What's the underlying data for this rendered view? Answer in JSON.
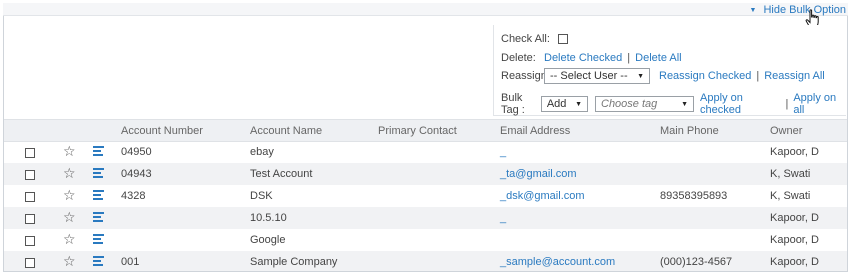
{
  "header": {
    "hide_bulk_label": "Hide Bulk Option"
  },
  "bulk": {
    "check_all_label": "Check All:",
    "delete_label": "Delete:",
    "delete_checked": "Delete Checked",
    "delete_all": "Delete All",
    "reassign_label": "Reassign:",
    "select_user_value": "-- Select User --",
    "reassign_checked": "Reassign Checked",
    "reassign_all": "Reassign All",
    "bulk_tag_label": "Bulk Tag :",
    "tag_action_value": "Add",
    "tag_placeholder": "Choose tag",
    "apply_checked": "Apply on checked",
    "apply_all": "Apply on all",
    "separator": "|"
  },
  "table": {
    "columns": [
      "Account Number",
      "Account Name",
      "Primary Contact",
      "Email Address",
      "Main Phone",
      "Owner"
    ],
    "rows": [
      {
        "account_number": "04950",
        "account_name": "ebay",
        "primary_contact": "",
        "email": "_",
        "phone": "",
        "owner": "Kapoor, D"
      },
      {
        "account_number": "04943",
        "account_name": "Test Account",
        "primary_contact": "",
        "email": "_ta@gmail.com",
        "phone": "",
        "owner": "K, Swati"
      },
      {
        "account_number": "4328",
        "account_name": "DSK",
        "primary_contact": "",
        "email": "_dsk@gmail.com",
        "phone": "89358395893",
        "owner": "K, Swati"
      },
      {
        "account_number": "",
        "account_name": "10.5.10",
        "primary_contact": "",
        "email": "_",
        "phone": "",
        "owner": "Kapoor, D"
      },
      {
        "account_number": "",
        "account_name": "Google",
        "primary_contact": "",
        "email": "",
        "phone": "",
        "owner": "Kapoor, D"
      },
      {
        "account_number": "001",
        "account_name": "Sample Company",
        "primary_contact": "",
        "email": "_sample@account.com",
        "phone": "(000)123-4567",
        "owner": "Kapoor, D"
      }
    ]
  },
  "icons": {
    "star": "star-icon",
    "details": "details-lines-icon",
    "caret": "caret-down-icon",
    "cursor": "hand-pointer-icon"
  },
  "colors": {
    "link": "#2a7ac0",
    "header_bg": "#eef0f3",
    "alt_row_bg": "#f1f2f4"
  }
}
